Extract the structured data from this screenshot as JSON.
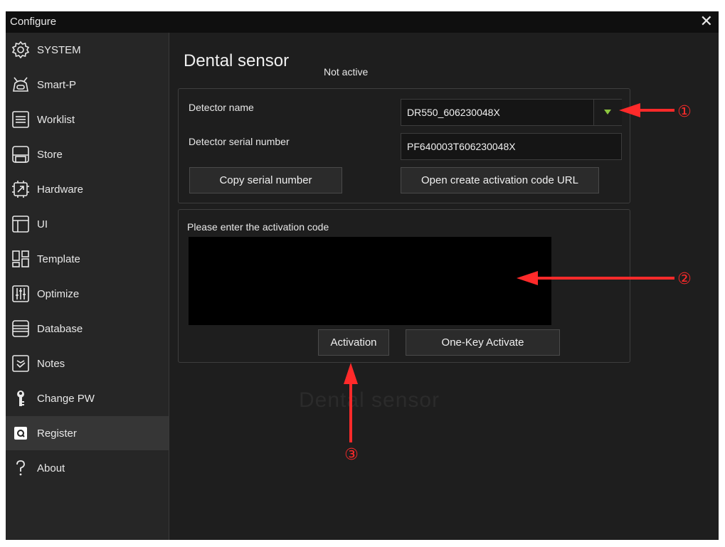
{
  "window": {
    "title": "Configure",
    "close_symbol": "✕"
  },
  "sidebar": {
    "items": [
      {
        "label": "SYSTEM",
        "icon": "gear-icon"
      },
      {
        "label": "Smart-P",
        "icon": "robot-icon"
      },
      {
        "label": "Worklist",
        "icon": "list-icon"
      },
      {
        "label": "Store",
        "icon": "save-icon"
      },
      {
        "label": "Hardware",
        "icon": "hardware-icon"
      },
      {
        "label": "UI",
        "icon": "layout-icon"
      },
      {
        "label": "Template",
        "icon": "template-icon"
      },
      {
        "label": "Optimize",
        "icon": "sliders-icon"
      },
      {
        "label": "Database",
        "icon": "database-icon"
      },
      {
        "label": "Notes",
        "icon": "checkbox-icon"
      },
      {
        "label": "Change PW",
        "icon": "key-icon"
      },
      {
        "label": "Register",
        "icon": "shield-icon",
        "active": true
      },
      {
        "label": "About",
        "icon": "question-icon"
      }
    ]
  },
  "main": {
    "title": "Dental sensor",
    "status": "Not active",
    "watermark": "Dental sensor",
    "detector_name_label": "Detector name",
    "detector_name_value": "DR550_606230048X",
    "serial_label": "Detector serial number",
    "serial_value": "PF640003T606230048X",
    "copy_serial_button": "Copy serial number",
    "open_url_button": "Open create activation code URL",
    "activation_prompt": "Please enter the activation code",
    "activation_code_value": "",
    "activation_button": "Activation",
    "one_key_button": "One-Key Activate"
  },
  "annotations": {
    "marker_1": "①",
    "marker_2": "②",
    "marker_3": "③"
  },
  "colors": {
    "window_bg": "#1c1c1c",
    "sidebar_bg": "#262626",
    "dropdown_arrow": "#8cc63f",
    "annotation_red": "#ff2a2a"
  }
}
